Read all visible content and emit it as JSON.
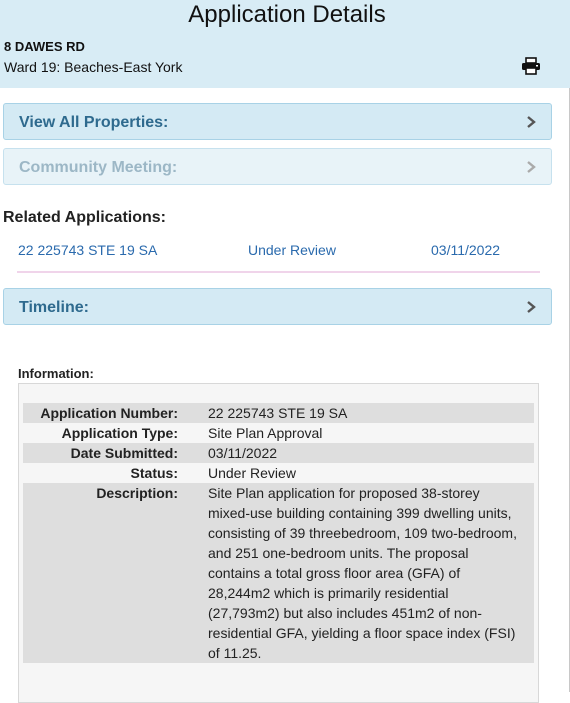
{
  "header": {
    "title": "Application Details",
    "address": "8 DAWES RD",
    "ward": "Ward 19: Beaches-East York",
    "print_icon": "printer-icon"
  },
  "accordions": {
    "properties": "View All Properties:",
    "community": "Community Meeting:",
    "timeline": "Timeline:",
    "chevron_icon": "chevron-right-icon"
  },
  "related": {
    "title": "Related Applications:",
    "rows": [
      {
        "number": "22 225743 STE 19 SA",
        "status": "Under Review",
        "date": "03/11/2022"
      }
    ]
  },
  "information": {
    "title": "Information:",
    "rows": [
      {
        "label": "Application Number:",
        "value": "22 225743 STE 19 SA"
      },
      {
        "label": "Application Type:",
        "value": "Site Plan Approval"
      },
      {
        "label": "Date Submitted:",
        "value": "03/11/2022"
      },
      {
        "label": "Status:",
        "value": "Under Review"
      },
      {
        "label": "Description:",
        "value": "Site Plan application for proposed 38-storey mixed-use building containing 399 dwelling units, consisting of 39 threebedroom, 109 two-bedroom, and 251 one-bedroom units. The proposal contains a total gross floor area (GFA) of 28,244m2 which is primarily residential (27,793m2) but also includes 451m2 of non-residential GFA, yielding a floor space index (FSI) of 11.25."
      }
    ]
  },
  "colors": {
    "header_bg": "#d8ecf5",
    "accordion_bg": "#d4eaf4",
    "link": "#2a6aad"
  }
}
